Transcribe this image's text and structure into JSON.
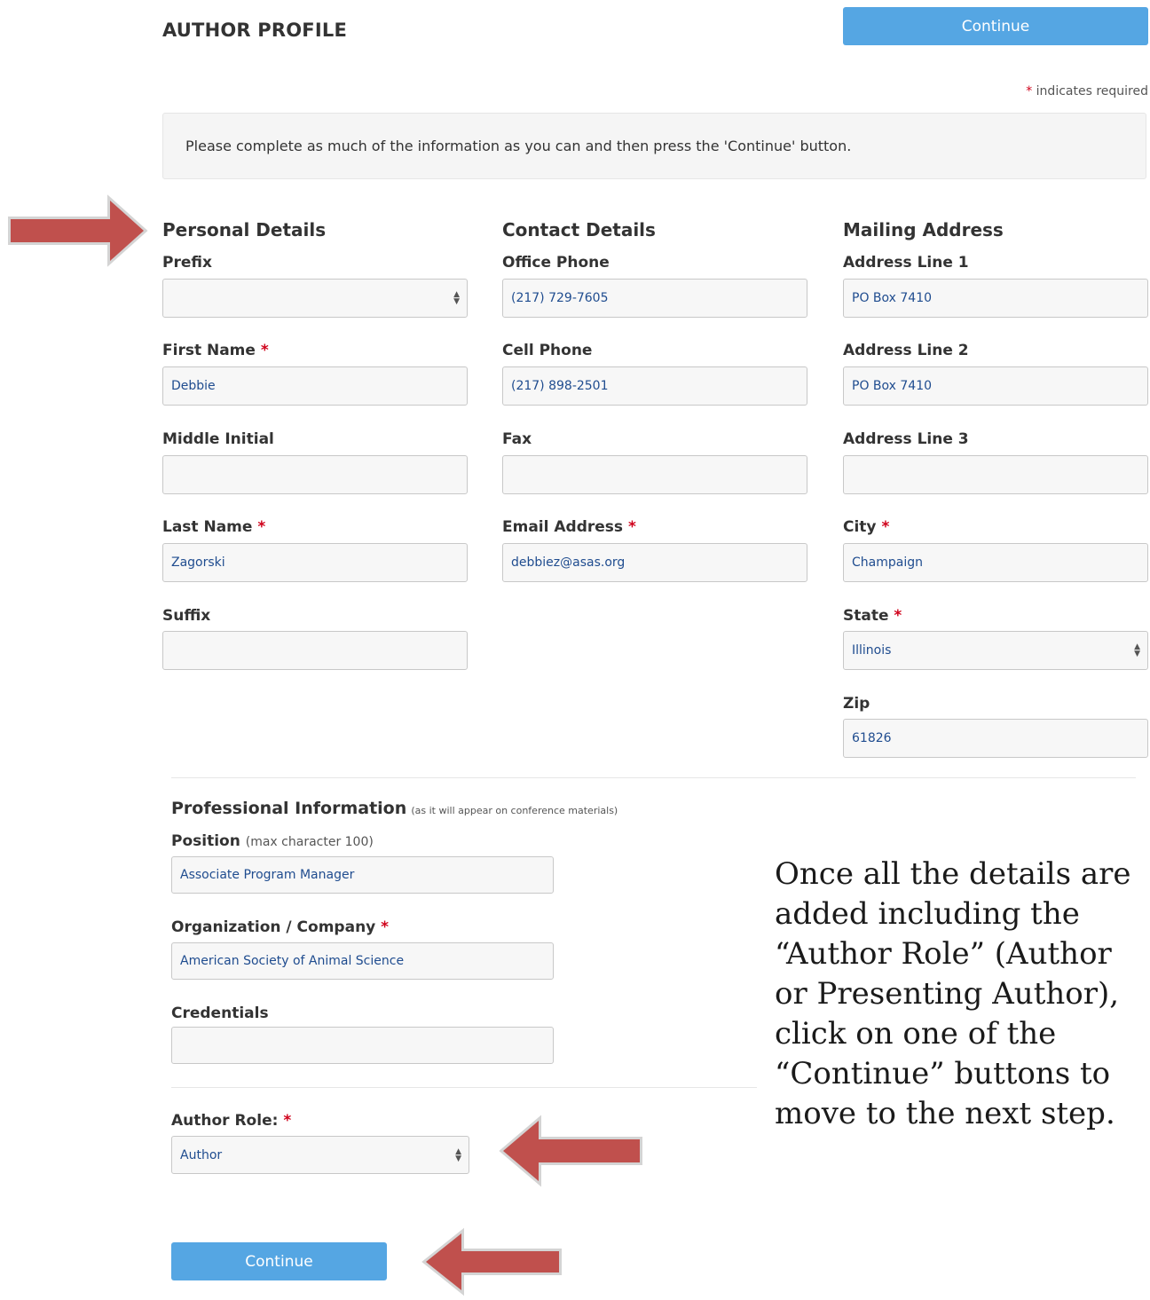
{
  "header": {
    "title": "AUTHOR PROFILE",
    "continue_label": "Continue",
    "required_star": "*",
    "required_note": "indicates required"
  },
  "info": "Please complete as much of the information as you can and then press the 'Continue' button.",
  "personal": {
    "heading": "Personal Details",
    "prefix": {
      "label": "Prefix",
      "value": ""
    },
    "first_name": {
      "label": "First Name",
      "value": "Debbie"
    },
    "middle_initial": {
      "label": "Middle Initial",
      "value": ""
    },
    "last_name": {
      "label": "Last Name",
      "value": "Zagorski"
    },
    "suffix": {
      "label": "Suffix",
      "value": ""
    }
  },
  "contact": {
    "heading": "Contact Details",
    "office_phone": {
      "label": "Office Phone",
      "value": "(217) 729-7605"
    },
    "cell_phone": {
      "label": "Cell Phone",
      "value": "(217) 898-2501"
    },
    "fax": {
      "label": "Fax",
      "value": ""
    },
    "email": {
      "label": "Email Address",
      "value": "debbiez@asas.org"
    }
  },
  "mailing": {
    "heading": "Mailing Address",
    "line1": {
      "label": "Address Line 1",
      "value": "PO Box 7410"
    },
    "line2": {
      "label": "Address Line 2",
      "value": "PO Box 7410"
    },
    "line3": {
      "label": "Address Line 3",
      "value": ""
    },
    "city": {
      "label": "City",
      "value": "Champaign"
    },
    "state": {
      "label": "State",
      "value": "Illinois"
    },
    "zip": {
      "label": "Zip",
      "value": "61826"
    }
  },
  "professional": {
    "heading": "Professional Information",
    "heading_note": "(as it will appear on conference materials)",
    "position": {
      "label": "Position",
      "note": "(max character 100)",
      "value": "Associate Program Manager"
    },
    "organization": {
      "label": "Organization / Company",
      "value": "American Society of Animal Science"
    },
    "credentials": {
      "label": "Credentials",
      "value": ""
    }
  },
  "author_role": {
    "label": "Author Role:",
    "value": "Author"
  },
  "footer": {
    "continue_label": "Continue"
  },
  "annotation": {
    "text": "Once all the details are added including the “Author Role” (Author or Presenting Author), click on one of the “Continue” buttons to move to the next step.",
    "arrow_color": "#c0504d"
  },
  "colors": {
    "button": "#55a6e3",
    "required": "#d0021b",
    "field_text": "#1f4c8f"
  }
}
